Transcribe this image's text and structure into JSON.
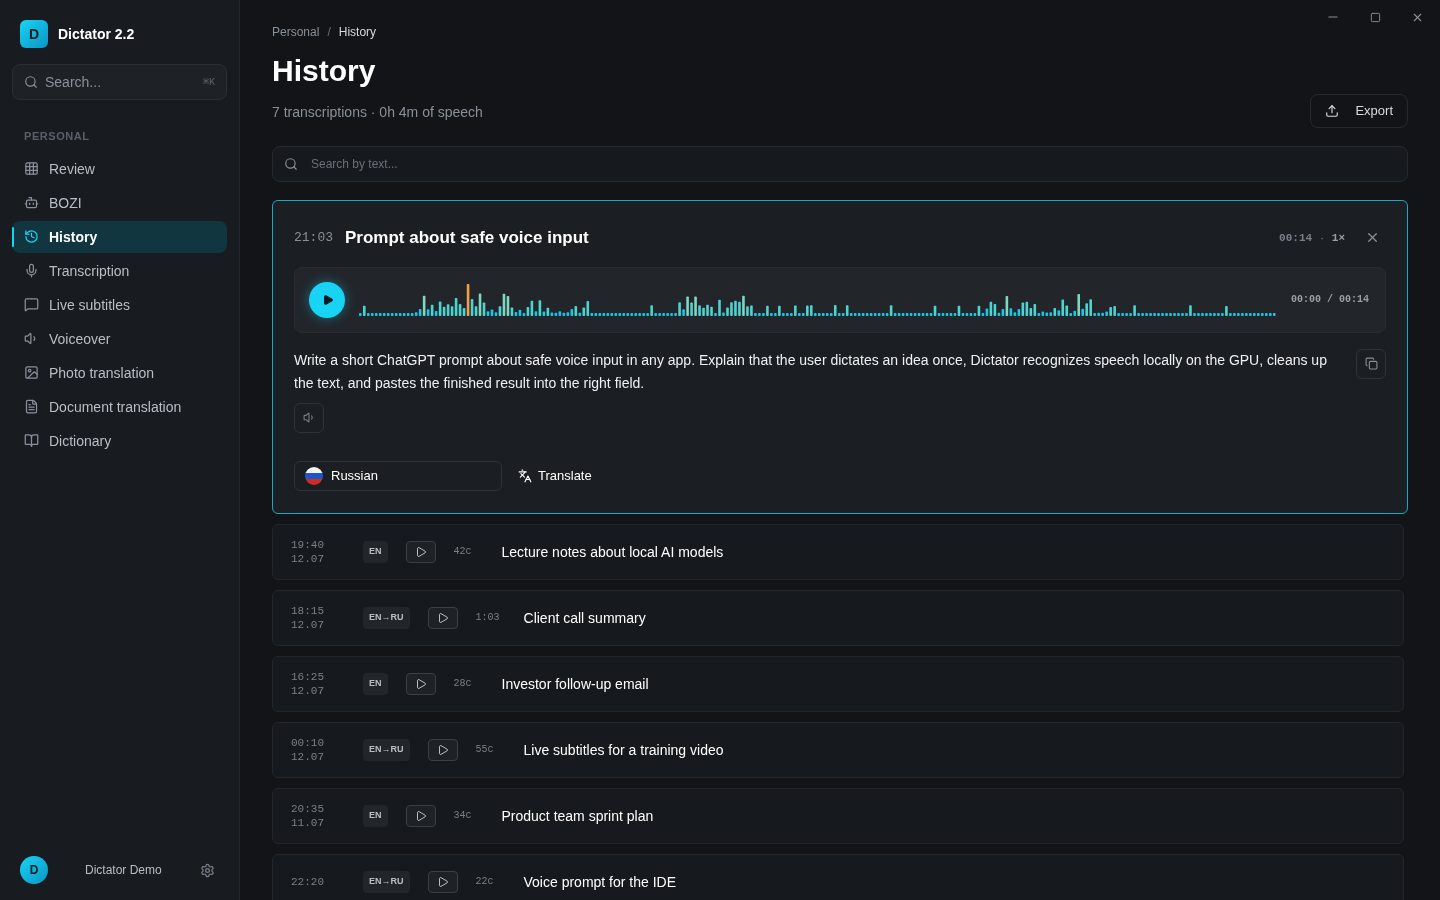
{
  "app": {
    "logo_letter": "D",
    "name": "Dictator 2.2"
  },
  "sidebar": {
    "search": {
      "placeholder": "Search...",
      "shortcut": "⌘K"
    },
    "section": "PERSONAL",
    "items": [
      {
        "label": "Review",
        "selected": false
      },
      {
        "label": "BOZI",
        "selected": false
      },
      {
        "label": "History",
        "selected": true
      },
      {
        "label": "Transcription",
        "selected": false
      },
      {
        "label": "Live subtitles",
        "selected": false
      },
      {
        "label": "Voiceover",
        "selected": false
      },
      {
        "label": "Photo translation",
        "selected": false
      },
      {
        "label": "Document translation",
        "selected": false
      },
      {
        "label": "Dictionary",
        "selected": false
      }
    ],
    "user": {
      "avatar_letter": "D",
      "name": "Dictator Demo"
    }
  },
  "breadcrumbs": {
    "items": [
      "Personal",
      "History"
    ],
    "separator": "/"
  },
  "page": {
    "title": "History",
    "subtitle": "7 transcriptions · 0h 4m of speech",
    "export_label": "Export"
  },
  "search": {
    "placeholder": "Search by text..."
  },
  "expanded": {
    "time": "21:03",
    "title": "Prompt about safe voice input",
    "duration": "00:14",
    "separator": "·",
    "speed": "1×",
    "player": {
      "reading": "00:00 / 00:14"
    },
    "text": "Write a short ChatGPT prompt about safe voice input in any app. Explain that the user dictates an idea once, Dictator recognizes speech locally on the GPU, cleans up the text, and pastes the finished result into the right field.",
    "language": "Russian",
    "translate_label": "Translate"
  },
  "rows": [
    {
      "time": "19:40",
      "date": "12.07",
      "lang": "EN",
      "meta": "42c",
      "title": "Lecture notes about local AI models"
    },
    {
      "time": "18:15",
      "date": "12.07",
      "lang": "EN→RU",
      "meta": "1:03",
      "title": "Client call summary"
    },
    {
      "time": "16:25",
      "date": "12.07",
      "lang": "EN",
      "meta": "28c",
      "title": "Investor follow-up email"
    },
    {
      "time": "00:10",
      "date": "12.07",
      "lang": "EN→RU",
      "meta": "55c",
      "title": "Live subtitles for a training video"
    },
    {
      "time": "20:35",
      "date": "11.07",
      "lang": "EN",
      "meta": "34c",
      "title": "Product team sprint plan"
    },
    {
      "time": "22:20",
      "lang": "EN→RU",
      "meta": "22c",
      "title": "Voice prompt for the IDE"
    }
  ]
}
